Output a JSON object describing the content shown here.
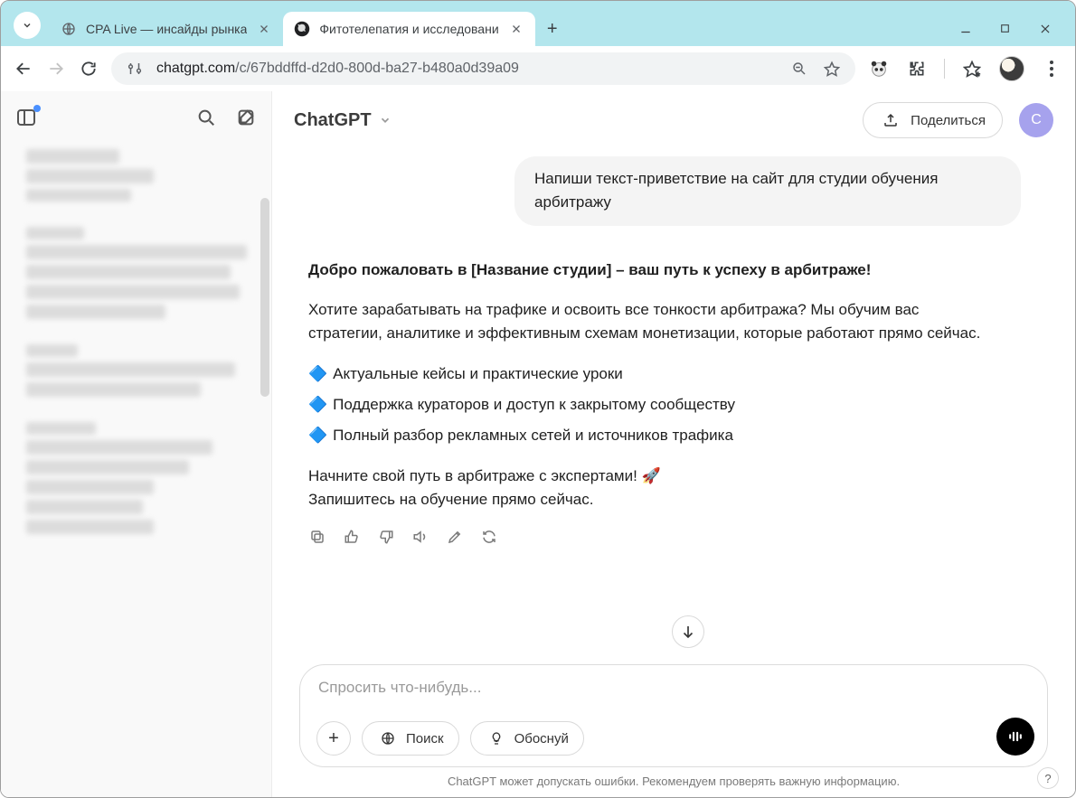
{
  "browser": {
    "tabs": [
      {
        "title": "CPA Live — инсайды рынка",
        "active": false
      },
      {
        "title": "Фитотелепатия и исследовани",
        "active": true
      }
    ],
    "url_domain": "chatgpt.com",
    "url_path": "/c/67bddffd-d2d0-800d-ba27-b480a0d39a09"
  },
  "app": {
    "model_label": "ChatGPT",
    "share_label": "Поделиться",
    "account_initial": "C"
  },
  "conversation": {
    "user_message": "Напиши текст-приветствие на сайт для студии обучения арбитражу",
    "assistant": {
      "heading": "Добро пожаловать в [Название студии] – ваш путь к успеху в арбитраже!",
      "para1": "Хотите зарабатывать на трафике и освоить все тонкости арбитража? Мы обучим вас стратегии, аналитике и эффективным схемам монетизации, которые работают прямо сейчас.",
      "bullets": [
        "Актуальные кейсы и практические уроки",
        "Поддержка кураторов и доступ к закрытому сообществу",
        "Полный разбор рекламных сетей и источников трафика"
      ],
      "outro1": "Начните свой путь в арбитраже с экспертами! 🚀",
      "outro2": "Запишитесь на обучение прямо сейчас."
    }
  },
  "composer": {
    "placeholder": "Спросить что-нибудь...",
    "search_label": "Поиск",
    "reason_label": "Обоснуй"
  },
  "footer": {
    "note": "ChatGPT может допускать ошибки. Рекомендуем проверять важную информацию."
  }
}
